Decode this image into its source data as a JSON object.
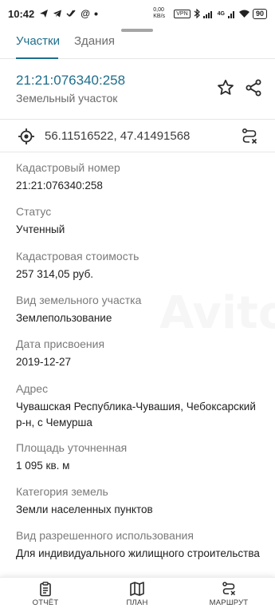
{
  "status_bar": {
    "time": "10:42",
    "network_speed": "0,00 KB/s",
    "vpn": "VPN",
    "signal": "4G",
    "battery": "90"
  },
  "tabs": [
    {
      "label": "Участки",
      "active": true
    },
    {
      "label": "Здания",
      "active": false
    }
  ],
  "plot": {
    "id": "21:21:076340:258",
    "type": "Земельный участок"
  },
  "coordinates": "56.11516522, 47.41491568",
  "fields": [
    {
      "label": "Кадастровый номер",
      "value": "21:21:076340:258"
    },
    {
      "label": "Статус",
      "value": "Учтенный"
    },
    {
      "label": "Кадастровая стоимость",
      "value": "257 314,05 руб."
    },
    {
      "label": "Вид земельного участка",
      "value": "Землепользование"
    },
    {
      "label": "Дата присвоения",
      "value": "2019-12-27"
    },
    {
      "label": "Адрес",
      "value": "Чувашская Республика-Чувашия, Чебоксарский р-н, с Чемурша"
    },
    {
      "label": "Площадь уточненная",
      "value": "1 095 кв. м"
    },
    {
      "label": "Категория земель",
      "value": "Земли населенных пунктов"
    },
    {
      "label": "Вид разрешенного использования",
      "value": "Для индивидуального жилищного строительства"
    }
  ],
  "bottom_nav": [
    {
      "label": "ОТЧЁТ",
      "icon": "clipboard-icon"
    },
    {
      "label": "ПЛАН",
      "icon": "map-icon"
    },
    {
      "label": "МАРШРУТ",
      "icon": "route-icon"
    }
  ],
  "colors": {
    "accent": "#1e6e8c",
    "label": "#7a7a7a",
    "text": "#212121"
  }
}
